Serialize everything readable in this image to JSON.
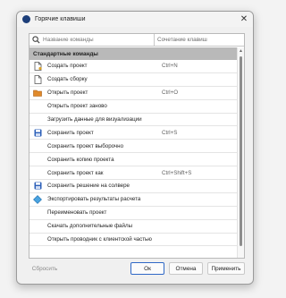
{
  "window": {
    "title": "Горячие клавиши",
    "close_icon": "close-icon"
  },
  "search": {
    "placeholder": "Название команды",
    "shortcut_header": "Сочетание клавиш"
  },
  "group": {
    "label": "Стандартные команды"
  },
  "commands": [
    {
      "name": "Создать проект",
      "shortcut": "Ctrl+N",
      "icon": "new-project-icon"
    },
    {
      "name": "Создать сборку",
      "shortcut": "",
      "icon": "document-icon"
    },
    {
      "name": "Открыть проект",
      "shortcut": "Ctrl+O",
      "icon": "folder-icon"
    },
    {
      "name": "Открыть проект заново",
      "shortcut": "",
      "icon": ""
    },
    {
      "name": "Загрузить данные для визуализации",
      "shortcut": "",
      "icon": ""
    },
    {
      "name": "Сохранить проект",
      "shortcut": "Ctrl+S",
      "icon": "save-icon"
    },
    {
      "name": "Сохранить проект выборочно",
      "shortcut": "",
      "icon": ""
    },
    {
      "name": "Сохранить копию проекта",
      "shortcut": "",
      "icon": ""
    },
    {
      "name": "Сохранить проект как",
      "shortcut": "Ctrl+Shift+S",
      "icon": ""
    },
    {
      "name": "Сохранить решение на солвере",
      "shortcut": "",
      "icon": "save-icon"
    },
    {
      "name": "Экспортировать результаты расчета",
      "shortcut": "",
      "icon": "export-icon"
    },
    {
      "name": "Переименовать проект",
      "shortcut": "",
      "icon": ""
    },
    {
      "name": "Скачать дополнительные файлы",
      "shortcut": "",
      "icon": ""
    },
    {
      "name": "Открыть проводник с клиентской частью",
      "shortcut": "",
      "icon": ""
    }
  ],
  "buttons": {
    "reset": "Сбросить",
    "ok": "Ок",
    "cancel": "Отмена",
    "apply": "Применить"
  },
  "colors": {
    "accent": "#2f68c6",
    "group_header_bg": "#b9b9b9",
    "folder": "#e08a2b",
    "save": "#2b5fb8"
  }
}
